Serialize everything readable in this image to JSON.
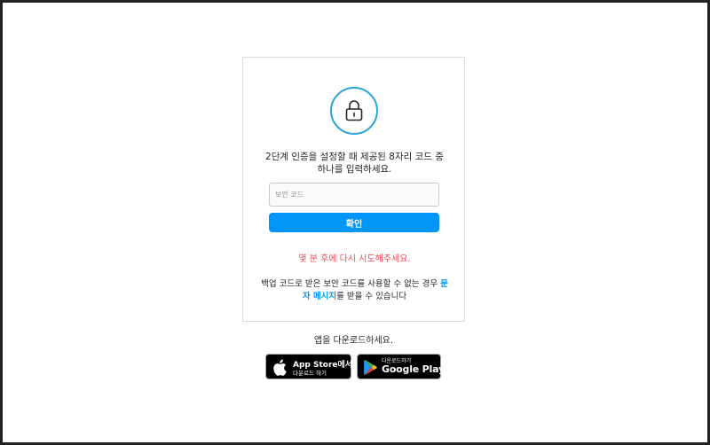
{
  "card": {
    "instruction": "2단계 인증을 설정할 때 제공된 8자리 코드 중 하나를 입력하세요.",
    "code_placeholder": "보안 코드",
    "code_value": "",
    "confirm_label": "확인",
    "error_message": "몇 분 후에 다시 시도해주세요.",
    "backup_prefix": "백업 코드로 받은 보안 코드를 사용할 수 없는 경우 ",
    "sms_link": "문자 메시지",
    "backup_suffix": "를 받을 수 있습니다"
  },
  "download": {
    "label": "앱을 다운로드하세요.",
    "appstore_line1": "App Store에서",
    "appstore_line2": "다운로드 하기",
    "googleplay_line1": "다운로드하기",
    "googleplay_line2": "Google Play"
  },
  "icons": {
    "lock": "lock-icon",
    "apple": "apple-icon",
    "google_play": "google-play-icon"
  },
  "colors": {
    "primary": "#0095f6",
    "lock_ring": "#2ea4d8",
    "error": "#ed4956",
    "border": "#dbdbdb"
  }
}
